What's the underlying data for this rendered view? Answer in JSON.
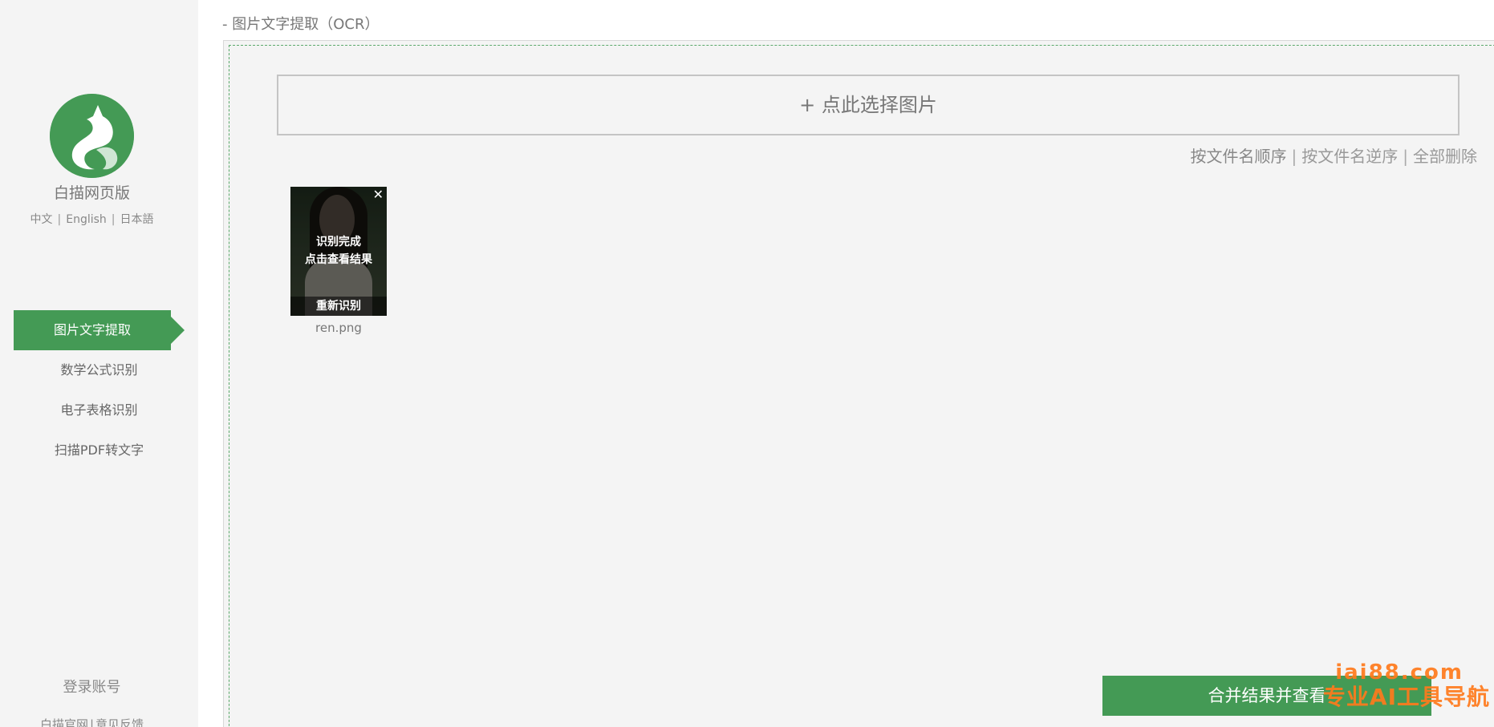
{
  "app": {
    "name": "白描网页版",
    "languages": [
      "中文",
      "English",
      "日本語"
    ],
    "colors": {
      "accent": "#449a55",
      "watermark": "#ff7a1c"
    }
  },
  "sidebar": {
    "items": [
      {
        "label": "图片文字提取",
        "active": true
      },
      {
        "label": "数学公式识别",
        "active": false
      },
      {
        "label": "电子表格识别",
        "active": false
      },
      {
        "label": "扫描PDF转文字",
        "active": false
      }
    ],
    "login_label": "登录账号",
    "footer": {
      "site_label": "白描官网",
      "separator": "|",
      "feedback_label": "意见反馈"
    }
  },
  "main": {
    "title": "- 图片文字提取（OCR）",
    "select_button_label": "+ 点此选择图片",
    "sort": {
      "asc_label": "按文件名顺序",
      "desc_label": "按文件名逆序",
      "delete_all_label": "全部删除",
      "separator": "|"
    },
    "files": [
      {
        "name": "ren.png",
        "status_line1": "识别完成",
        "status_line2": "点击查看结果",
        "retry_label": "重新识别",
        "close_glyph": "✕"
      }
    ],
    "merge_button_label": "合并结果并查看"
  },
  "watermark": {
    "line1": "iai88.com",
    "line2": "专业AI工具导航"
  }
}
